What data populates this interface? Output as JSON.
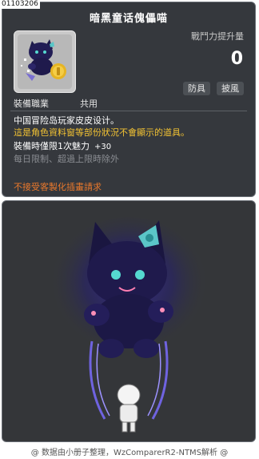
{
  "item_id": "01103206",
  "title": "暗黑童话傀儡喵",
  "power": {
    "label": "戰鬥力提升量",
    "value": "0"
  },
  "tags": [
    "防具",
    "披風"
  ],
  "job": {
    "label": "裝備職業",
    "value": "共用"
  },
  "description": {
    "line1": "中国冒险岛玩家皮皮设计。",
    "line2": "這是角色資料窗等部份狀況不會顯示的道具。"
  },
  "stat": {
    "label": "裝備時僅限1次魅力",
    "bonus": "+30"
  },
  "limit_note": "每日限制、超過上限時除外",
  "craft_note": "不接受客製化插畫請求",
  "footer": "@ 数据由小册子整理，WzComparerR2-NTMS解析 @",
  "colors": {
    "panel": "#35383d",
    "highlight": "#f2c233",
    "warning": "#e8782c",
    "muted": "#8a8d92"
  },
  "icons": {
    "item": "dark-cat-doll-cape-icon"
  }
}
